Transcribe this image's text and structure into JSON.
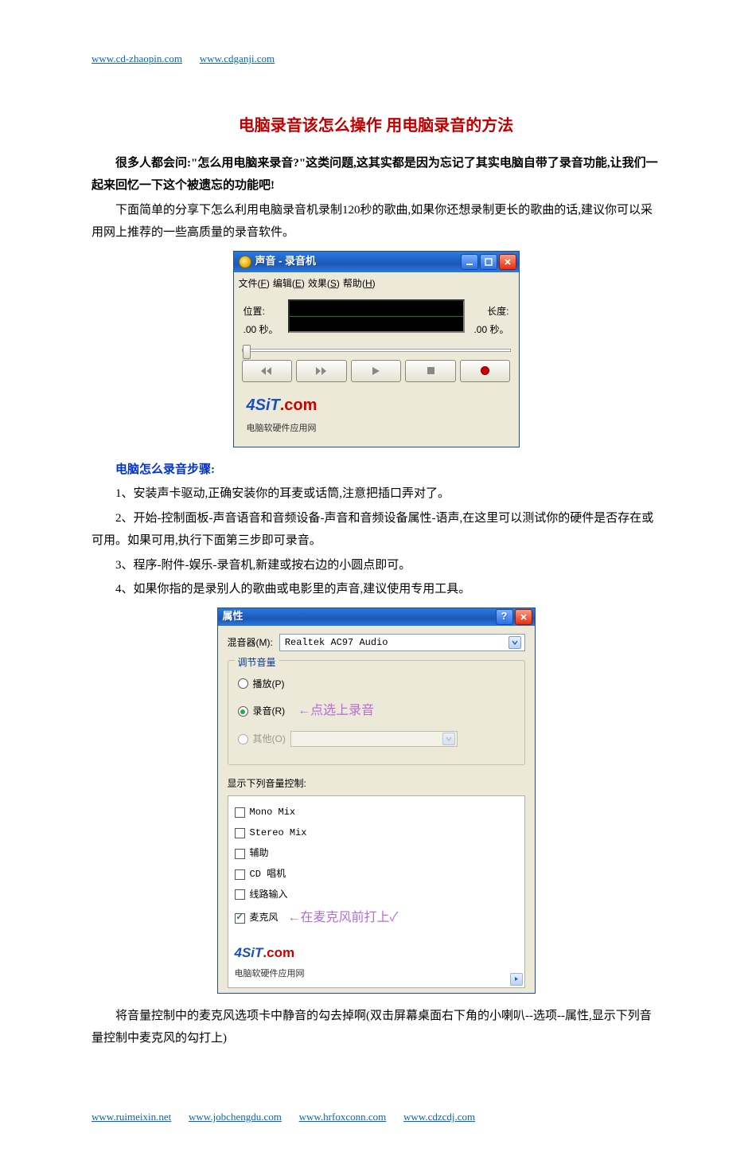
{
  "header_links": [
    {
      "text": "www.cd-zhaopin.com"
    },
    {
      "text": "www.cdganji.com"
    }
  ],
  "title": "电脑录音该怎么操作 用电脑录音的方法",
  "intro_bold": "很多人都会问:\"怎么用电脑来录音?\"这类问题,这其实都是因为忘记了其实电脑自带了录音功能,让我们一起来回忆一下这个被遗忘的功能吧!",
  "intro_para": "下面简单的分享下怎么利用电脑录音机录制120秒的歌曲,如果你还想录制更长的歌曲的话,建议你可以采用网上推荐的一些高质量的录音软件。",
  "recorder": {
    "title": "声音 - 录音机",
    "menus": {
      "file": "文件",
      "file_u": "F",
      "edit": "编辑",
      "edit_u": "E",
      "effects": "效果",
      "effects_u": "S",
      "help": "帮助",
      "help_u": "H"
    },
    "left_label": "位置:",
    "left_value": ".00 秒。",
    "right_label": "长度:",
    "right_value": ".00 秒。"
  },
  "brand": {
    "logo_main": "4SiT",
    "logo_ext": ".com",
    "subtitle": "电脑软硬件应用网"
  },
  "steps_head": "电脑怎么录音步骤:",
  "steps": {
    "s1": "1、安装声卡驱动,正确安装你的耳麦或话筒,注意把插口弄对了。",
    "s2": "2、开始-控制面板-声音语音和音频设备-声音和音频设备属性-语声,在这里可以测试你的硬件是否存在或可用。如果可用,执行下面第三步即可录音。",
    "s3": "3、程序-附件-娱乐-录音机,新建或按右边的小圆点即可。",
    "s4": "4、如果你指的是录别人的歌曲或电影里的声音,建议使用专用工具。"
  },
  "properties": {
    "title": "属性",
    "mixer_label": "混音器(M):",
    "mixer_value": "Realtek AC97 Audio",
    "legend": "调节音量",
    "radio_play": "播放(P)",
    "radio_record": "录音(R)",
    "radio_other": "其他(O)",
    "hand_note_record": "←点选上录音",
    "list_label": "显示下列音量控制:",
    "controls": [
      {
        "label": "Mono Mix",
        "checked": false
      },
      {
        "label": "Stereo Mix",
        "checked": false
      },
      {
        "label": "辅助",
        "checked": false
      },
      {
        "label": "CD 唱机",
        "checked": false
      },
      {
        "label": "线路输入",
        "checked": false
      },
      {
        "label": "麦克风",
        "checked": true
      }
    ],
    "hand_note_mic": "←在麦克风前打上✓"
  },
  "closing_para": "将音量控制中的麦克风选项卡中静音的勾去掉啊(双击屏幕桌面右下角的小喇叭--选项--属性,显示下列音量控制中麦克风的勾打上)",
  "footer_links": [
    {
      "text": "www.ruimeixin.net"
    },
    {
      "text": "www.jobchengdu.com"
    },
    {
      "text": "www.hrfoxconn.com"
    },
    {
      "text": "www.cdzcdj.com"
    }
  ]
}
